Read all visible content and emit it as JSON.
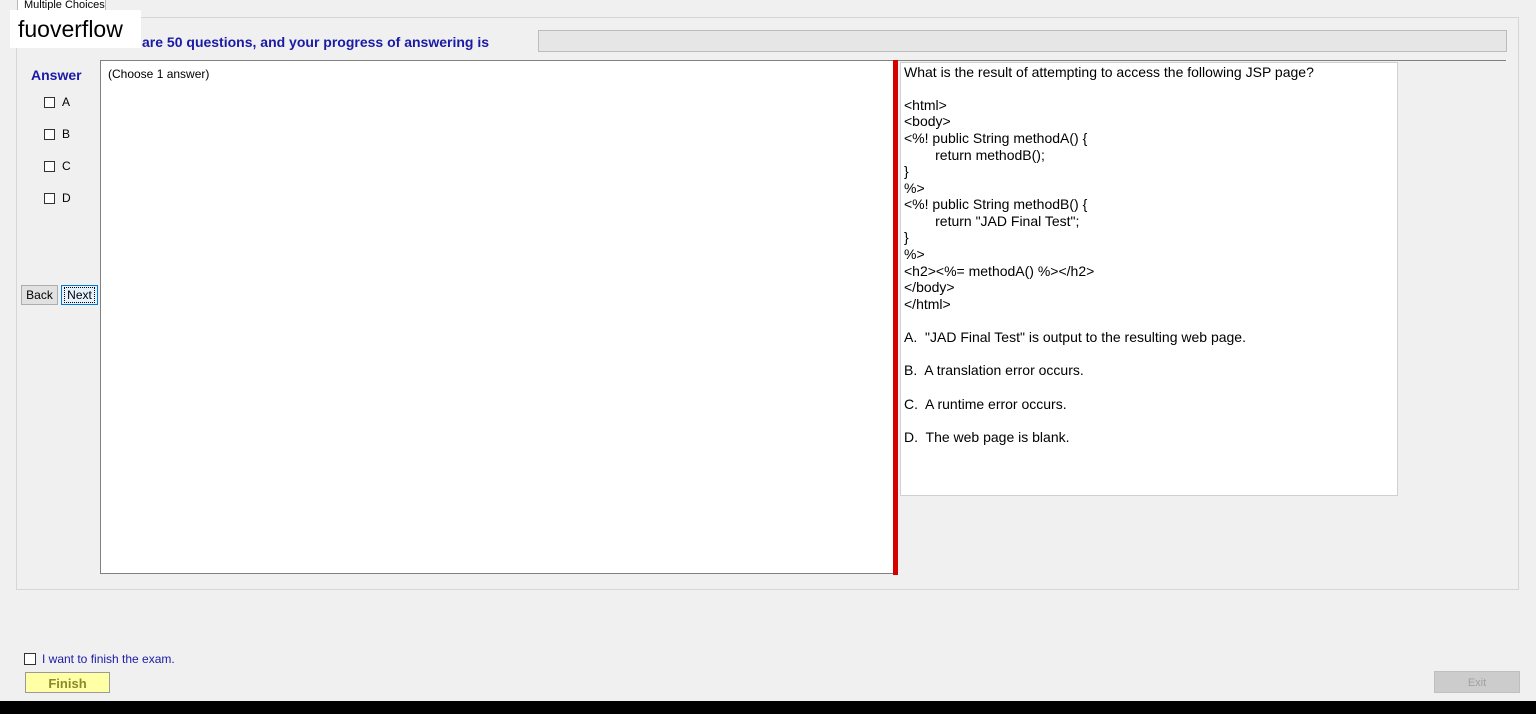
{
  "tab": {
    "label": "Multiple Choices"
  },
  "watermark": "fuoverflow",
  "progress": {
    "text": "There are 50 questions, and your progress of answering is",
    "value": 0
  },
  "answer_panel": {
    "heading": "Answer",
    "options": [
      "A",
      "B",
      "C",
      "D"
    ]
  },
  "nav": {
    "back_label": "Back",
    "next_label": "Next"
  },
  "answer_box": {
    "hint": "(Choose 1 answer)"
  },
  "question": {
    "lines": [
      "What is the result of attempting to access the following JSP page?",
      "<html>",
      "<body>",
      "<%! public String methodA() {",
      "        return methodB();",
      "}",
      "%>",
      "<%! public String methodB() {",
      "        return \"JAD Final Test\";",
      "}",
      "%>",
      "<h2><%= methodA() %></h2>",
      "</body>",
      "</html>",
      "A.  \"JAD Final Test\" is output to the resulting web page.",
      "B.  A translation error occurs.",
      "C.  A runtime error occurs.",
      "D.  The web page is blank."
    ]
  },
  "footer": {
    "finish_check_label": "I want to finish the exam.",
    "finish_label": "Finish",
    "exit_label": "Exit"
  },
  "colors": {
    "accent_text": "#1a1aa6",
    "splitter": "#d40000",
    "finish_bg": "#ffffa6"
  }
}
